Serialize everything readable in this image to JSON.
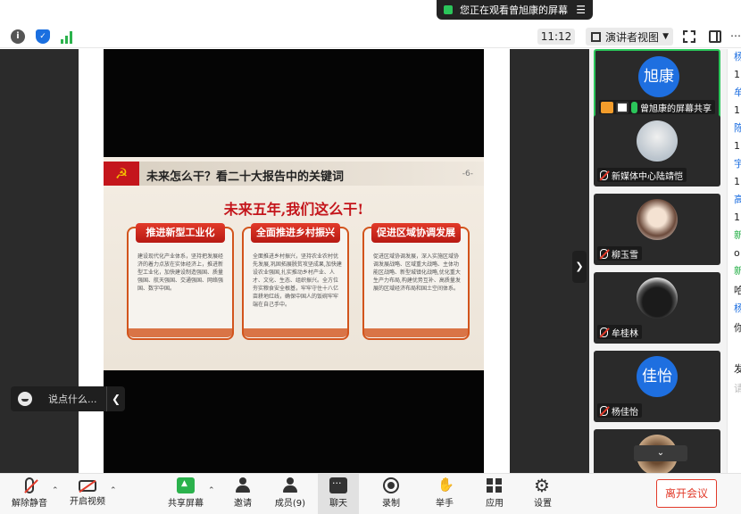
{
  "banner": {
    "text": "您正在观看曾旭康的屏幕",
    "menu_icon": "menu-icon"
  },
  "toolbar": {
    "info_icon": "i",
    "time": "11:12",
    "view_label": "演讲者视图"
  },
  "slide": {
    "title": "未来怎么干？看二十大报告中的关键词",
    "page": "-6-",
    "subtitle": "未来五年,我们这么干!",
    "cards": [
      {
        "title": "推进新型工业化",
        "body": "建设现代化产业体系，坚持把发展经济的着力点放在实体经济上，推进新型工业化，加快建设制造强国、质量强国、航天强国、交通强国、网络强国、数字中国。"
      },
      {
        "title": "全面推进乡村振兴",
        "body": "全面推进乡村振兴，坚持农业农村优先发展,巩固拓展脱贫攻坚成果,加快建设农业强国,扎实推动乡村产业、人才、文化、生态、组织振兴。全方位夯实粮食安全根基，牢牢守住十八亿亩耕地红线，确保中国人的饭碗牢牢端在自己手中。"
      },
      {
        "title": "促进区域协调发展",
        "body": "促进区域协调发展，深入实施区域协调发展战略、区域重大战略、主体功能区战略、新型城镇化战略,优化重大生产力布局,构建优势互补、高质量发展的区域经济布局和国土空间体系。"
      }
    ]
  },
  "chat_overlay": {
    "placeholder": "说点什么..."
  },
  "participants": [
    {
      "name": "曾旭康的屏幕共享",
      "avatar_text": "旭康",
      "avatar_style": "blue",
      "active": true
    },
    {
      "name": "新媒体中心陆靖恺",
      "avatar_text": "",
      "avatar_style": "photo1",
      "active": false
    },
    {
      "name": "柳玉雪",
      "avatar_text": "",
      "avatar_style": "photo2",
      "active": false
    },
    {
      "name": "牟桂林",
      "avatar_text": "",
      "avatar_style": "photo3",
      "active": false
    },
    {
      "name": "杨佳怡",
      "avatar_text": "佳怡",
      "avatar_style": "blue",
      "active": false
    },
    {
      "name": "",
      "avatar_text": "",
      "avatar_style": "photo4",
      "active": false
    }
  ],
  "chat_strip": [
    {
      "text": "杨",
      "color": "#1e6fe0"
    },
    {
      "text": "1",
      "color": "#222222"
    },
    {
      "text": "牟",
      "color": "#1e6fe0"
    },
    {
      "text": "1",
      "color": "#222222"
    },
    {
      "text": "陈",
      "color": "#1e6fe0"
    },
    {
      "text": "1",
      "color": "#222222"
    },
    {
      "text": "宇",
      "color": "#1e6fe0"
    },
    {
      "text": "1",
      "color": "#222222"
    },
    {
      "text": "高",
      "color": "#1e6fe0"
    },
    {
      "text": "1",
      "color": "#222222"
    },
    {
      "text": "新",
      "color": "#2bb24c"
    },
    {
      "text": "o",
      "color": "#222222"
    },
    {
      "text": "新",
      "color": "#2bb24c"
    },
    {
      "text": "哈",
      "color": "#222222"
    },
    {
      "text": "杨",
      "color": "#1e6fe0"
    },
    {
      "text": "你",
      "color": "#222222"
    },
    {
      "text": "发",
      "color": "#222222"
    },
    {
      "text": "请",
      "color": "#bbbbbb"
    }
  ],
  "bottom": {
    "unmute": "解除静音",
    "start_video": "开启视频",
    "share_screen": "共享屏幕",
    "invite": "邀请",
    "members": "成员(9)",
    "chat": "聊天",
    "record": "录制",
    "raise_hand": "举手",
    "apps": "应用",
    "settings": "设置",
    "leave": "离开会议"
  },
  "colors": {
    "accent_green": "#2bc55a",
    "brand_blue": "#1e6fe0",
    "leave_red": "#e23a2a"
  }
}
